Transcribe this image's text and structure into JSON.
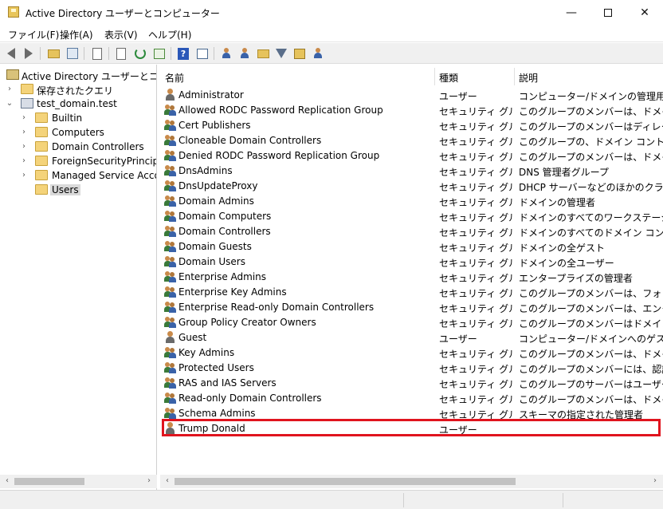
{
  "window": {
    "title": "Active Directory ユーザーとコンピューター",
    "minimize_label": "—",
    "close_label": "✕"
  },
  "menu": [
    "ファイル(F)",
    "操作(A)",
    "表示(V)",
    "ヘルプ(H)"
  ],
  "toolbar": {
    "help_label": "?"
  },
  "tree": {
    "root": "Active Directory ユーザーとコンピューター",
    "saved_queries": "保存されたクエリ",
    "domain": "test_domain.test",
    "children": [
      "Builtin",
      "Computers",
      "Domain Controllers",
      "ForeignSecurityPrincipals",
      "Managed Service Accounts",
      "Users"
    ],
    "selected": "Users"
  },
  "columns": {
    "name": "名前",
    "type": "種類",
    "description": "説明"
  },
  "rows": [
    {
      "name": "Administrator",
      "type": "ユーザー",
      "description": "コンピューター/ドメインの管理用 (ビルトイン アカウント)",
      "icon": "user-icon"
    },
    {
      "name": "Allowed RODC Password Replication Group",
      "type": "セキュリティ グループ",
      "description": "このグループのメンバーは、ドメインのすべての読み取り専用ドメイン コントローラー",
      "icon": "group-icon"
    },
    {
      "name": "Cert Publishers",
      "type": "セキュリティ グループ",
      "description": "このグループのメンバーはディレクトリに証明書を発行できます",
      "icon": "group-icon"
    },
    {
      "name": "Cloneable Domain Controllers",
      "type": "セキュリティ グループ",
      "description": "このグループの、ドメイン コントローラーであるメンバーは複製できます",
      "icon": "group-icon"
    },
    {
      "name": "Denied RODC Password Replication Group",
      "type": "セキュリティ グループ",
      "description": "このグループのメンバーは、ドメインのどの読み取り専用ドメイン コントローラー",
      "icon": "group-icon"
    },
    {
      "name": "DnsAdmins",
      "type": "セキュリティ グループ",
      "description": "DNS 管理者グループ",
      "icon": "group-icon"
    },
    {
      "name": "DnsUpdateProxy",
      "type": "セキュリティ グループ",
      "description": "DHCP サーバーなどのほかのクライアントの代わりに",
      "icon": "group-icon"
    },
    {
      "name": "Domain Admins",
      "type": "セキュリティ グループ",
      "description": "ドメインの管理者",
      "icon": "group-icon"
    },
    {
      "name": "Domain Computers",
      "type": "セキュリティ グループ",
      "description": "ドメインのすべてのワークステーションとサーバー",
      "icon": "group-icon"
    },
    {
      "name": "Domain Controllers",
      "type": "セキュリティ グループ",
      "description": "ドメインのすべてのドメイン コントローラー",
      "icon": "group-icon"
    },
    {
      "name": "Domain Guests",
      "type": "セキュリティ グループ",
      "description": "ドメインの全ゲスト",
      "icon": "group-icon"
    },
    {
      "name": "Domain Users",
      "type": "セキュリティ グループ",
      "description": "ドメインの全ユーザー",
      "icon": "group-icon"
    },
    {
      "name": "Enterprise Admins",
      "type": "セキュリティ グループ",
      "description": "エンタープライズの管理者",
      "icon": "group-icon"
    },
    {
      "name": "Enterprise Key Admins",
      "type": "セキュリティ グループ",
      "description": "このグループのメンバーは、フォレスト内のキー",
      "icon": "group-icon"
    },
    {
      "name": "Enterprise Read-only Domain Controllers",
      "type": "セキュリティ グループ",
      "description": "このグループのメンバーは、エンタープライズの読み取り専用ドメイン",
      "icon": "group-icon"
    },
    {
      "name": "Group Policy Creator Owners",
      "type": "セキュリティ グループ",
      "description": "このグループのメンバーはドメインのグループ ポリシー",
      "icon": "group-icon"
    },
    {
      "name": "Guest",
      "type": "ユーザー",
      "description": "コンピューター/ドメインへのゲスト アクセス用",
      "icon": "user-icon"
    },
    {
      "name": "Key Admins",
      "type": "セキュリティ グループ",
      "description": "このグループのメンバーは、ドメイン内のキー",
      "icon": "group-icon"
    },
    {
      "name": "Protected Users",
      "type": "セキュリティ グループ",
      "description": "このグループのメンバーには、認証セキュリティ",
      "icon": "group-icon"
    },
    {
      "name": "RAS and IAS Servers",
      "type": "セキュリティ グループ",
      "description": "このグループのサーバーはユーザーのリモート アクセス",
      "icon": "group-icon"
    },
    {
      "name": "Read-only Domain Controllers",
      "type": "セキュリティ グループ",
      "description": "このグループのメンバーは、ドメインの読み取り専用",
      "icon": "group-icon"
    },
    {
      "name": "Schema Admins",
      "type": "セキュリティ グループ",
      "description": "スキーマの指定された管理者",
      "icon": "group-icon"
    },
    {
      "name": "Trump Donald",
      "type": "ユーザー",
      "description": "",
      "icon": "user-icon",
      "highlighted": true
    }
  ],
  "colors": {
    "highlight_border": "#e0141e",
    "selection": "#d9d9d9",
    "toolbar_bg": "#f0f0f0"
  }
}
